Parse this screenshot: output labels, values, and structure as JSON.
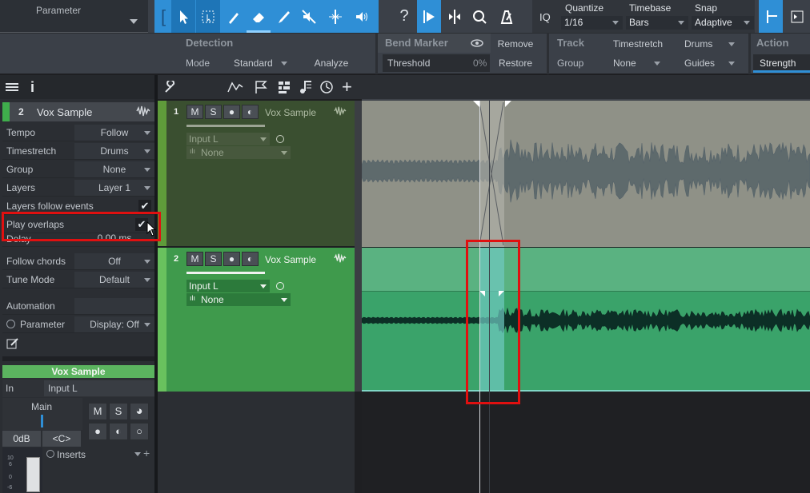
{
  "toolbar": {
    "parameter_label": "Parameter",
    "quantize_label": "Quantize",
    "quantize_value": "1/16",
    "timebase_label": "Timebase",
    "timebase_value": "Bars",
    "snap_label": "Snap",
    "snap_value": "Adaptive",
    "iq_label": "IQ"
  },
  "inspector_bar": {
    "detection_title": "Detection",
    "mode_label": "Mode",
    "mode_value": "Standard",
    "analyze_label": "Analyze",
    "bend_marker_title": "Bend Marker",
    "threshold_label": "Threshold",
    "threshold_value": "0%",
    "remove_label": "Remove",
    "restore_label": "Restore",
    "track_title": "Track",
    "group_label": "Group",
    "group_value": "None",
    "timestretch_label": "Timestretch",
    "timestretch_value": "Drums",
    "guides_label": "Guides",
    "action_title": "Action",
    "strength_label": "Strength"
  },
  "inspector": {
    "track_number": "2",
    "track_name": "Vox Sample",
    "rows": [
      {
        "label": "Tempo",
        "value": "Follow"
      },
      {
        "label": "Timestretch",
        "value": "Drums"
      },
      {
        "label": "Group",
        "value": "None"
      },
      {
        "label": "Layers",
        "value": "Layer 1"
      }
    ],
    "layers_follow_events": "Layers follow events",
    "play_overlaps": "Play overlaps",
    "delay_label": "Delay",
    "delay_value": "0.00 ms",
    "follow_chords_label": "Follow chords",
    "follow_chords_value": "Off",
    "tune_mode_label": "Tune Mode",
    "tune_mode_value": "Default",
    "automation_label": "Automation",
    "parameter_label": "Parameter",
    "display_value": "Display: Off"
  },
  "channel": {
    "name": "Vox Sample",
    "in_label": "In",
    "input_value": "Input L",
    "main_label": "Main",
    "db_value": "0dB",
    "pan_value": "<C>",
    "inserts_label": "Inserts",
    "m_label": "M",
    "s_label": "S",
    "scale": [
      "10",
      "6",
      "0",
      "-6"
    ]
  },
  "tracks": [
    {
      "number": "1",
      "name": "Vox Sample",
      "input": "Input L",
      "aux": "None"
    },
    {
      "number": "2",
      "name": "Vox Sample",
      "input": "Input L",
      "aux": "None"
    }
  ],
  "colors": {
    "accent_blue": "#2f8fd6",
    "track1_header": "#3a4f30",
    "track2_header": "#3f9a4c",
    "clip_gray": "#8f9187",
    "clip_green": "#3aa36a",
    "highlight_red": "#e01010"
  }
}
